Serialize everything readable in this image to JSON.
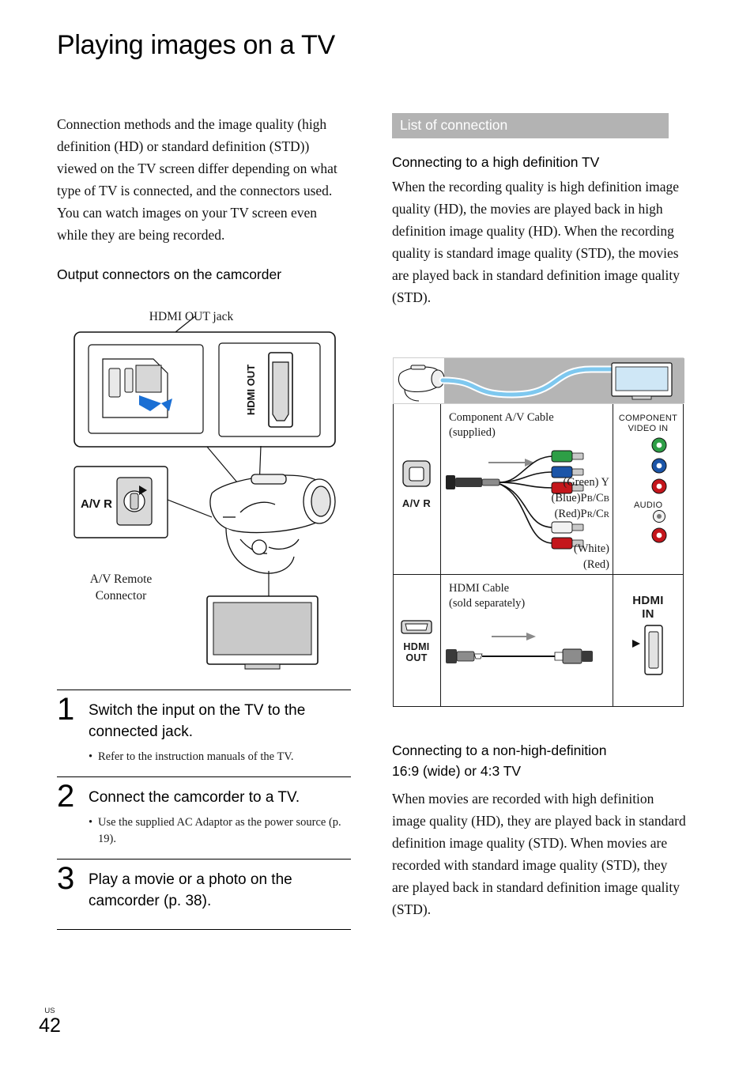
{
  "page": {
    "title": "Playing images on a TV",
    "footer_locale": "US",
    "footer_page": "42"
  },
  "left": {
    "intro": "Connection methods and the image quality (high definition (HD) or standard definition (STD)) viewed on the TV screen differ depending on what type of TV is connected, and the connectors used. You can watch images on your TV screen even while they are being recorded.",
    "subhead": "Output connectors on the camcorder",
    "figure": {
      "caption_top": "HDMI OUT jack",
      "hdmi_label": "HDMI OUT",
      "av_label": "A/V R",
      "caption_bottom_line1": "A/V Remote",
      "caption_bottom_line2": "Connector"
    },
    "steps": [
      {
        "num": "1",
        "title": "Switch the input on the TV to the connected jack.",
        "note": "Refer to the instruction manuals of the TV."
      },
      {
        "num": "2",
        "title": "Connect the camcorder to a TV.",
        "note": "Use the supplied AC Adaptor as the power source (p. 19)."
      },
      {
        "num": "3",
        "title": "Play a movie or a photo on the camcorder (p. 38).",
        "note": ""
      }
    ]
  },
  "right": {
    "band_title": "List of connection",
    "section1": {
      "heading": "Connecting to a high definition TV",
      "paragraph": "When the recording quality is high definition image quality (HD), the movies are played back in high definition image quality (HD). When the recording quality is standard image quality (STD), the movies are played back in standard definition image quality (STD)."
    },
    "diagram": {
      "row1": {
        "connector": "A/V  R",
        "cable_line1": "Component A/V Cable",
        "cable_line2": "(supplied)",
        "plug_green": "(Green) Y",
        "plug_blue": "(Blue)PB/CB",
        "plug_red": "(Red)PR/CR",
        "plug_white": "(White)",
        "plug_red2": "(Red)",
        "tv_component_line1": "COMPONENT",
        "tv_component_line2": "VIDEO IN",
        "tv_audio": "AUDIO"
      },
      "row2": {
        "connector": "HDMI OUT",
        "cable_line1": "HDMI Cable",
        "cable_line2": "(sold separately)",
        "tv_hdmi_line1": "HDMI",
        "tv_hdmi_line2": "IN"
      }
    },
    "section2": {
      "heading_line1": "Connecting to a non-high-definition",
      "heading_line2": "16:9 (wide) or 4:3 TV",
      "paragraph": "When movies are recorded with high definition image quality (HD), they are played back in standard definition image quality (STD). When movies are recorded with standard image quality (STD), they are played back in standard definition image quality (STD)."
    }
  },
  "colors": {
    "band_bg": "#b3b3b3",
    "green": "#2e9e46",
    "blue": "#1b55a8",
    "red": "#c4161c",
    "white_plug": "#f2f2f2",
    "gray_device": "#b5b5b5",
    "cable_blue": "#7ec8ef"
  }
}
